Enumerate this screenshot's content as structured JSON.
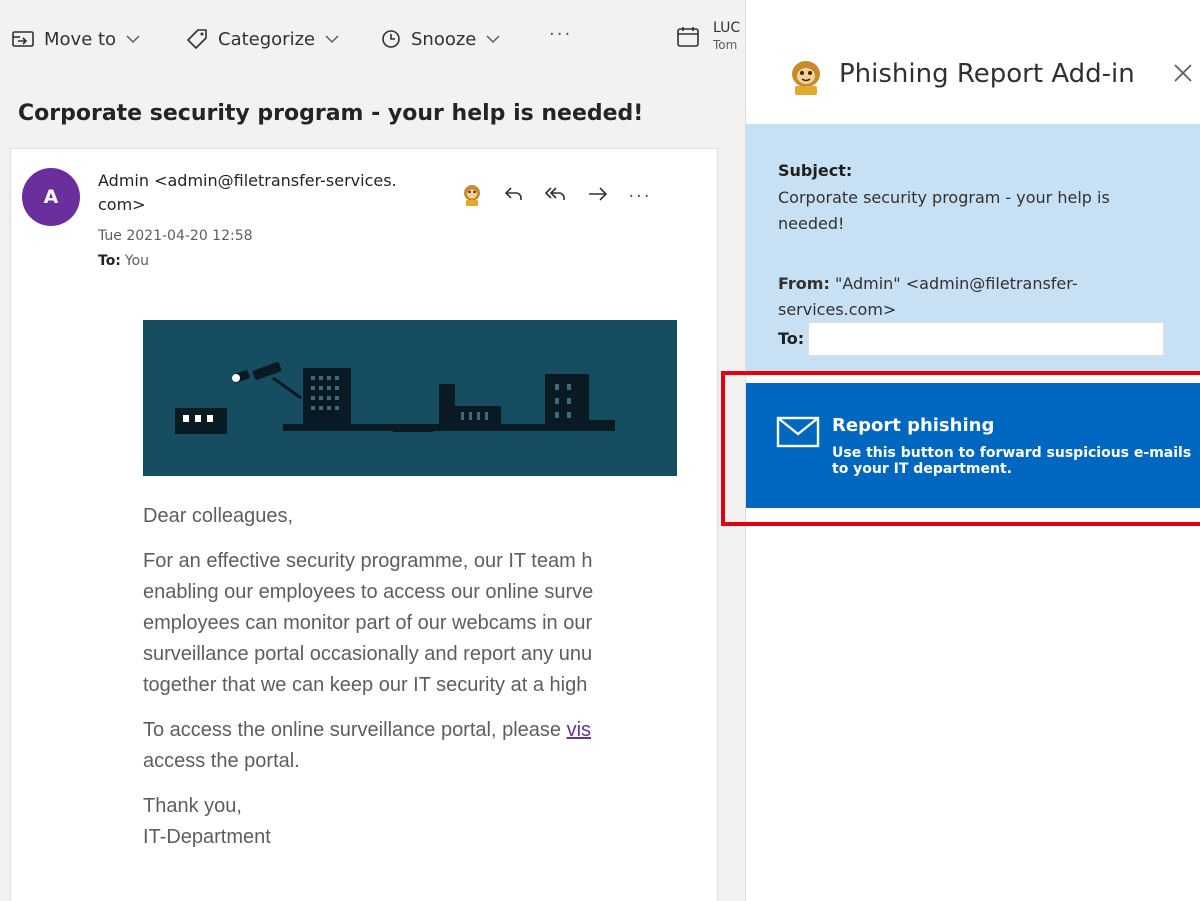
{
  "toolbar": {
    "move_to_label": "Move to",
    "categorize_label": "Categorize",
    "snooze_label": "Snooze",
    "more_label": "···",
    "peek_name": "LUC",
    "peek_sub": "Tom"
  },
  "email": {
    "subject": "Corporate security program - your help is needed!",
    "avatar_initial": "A",
    "sender": "Admin <admin@filetransfer-services.com>",
    "date": "Tue 2021-04-20 12:58",
    "to_label": "To:",
    "to_value": "You",
    "more_label": "···",
    "body": {
      "greeting": "Dear colleagues,",
      "para1_lines": [
        "For an effective security programme, our IT team h",
        "enabling our employees to access our online surve",
        "employees can monitor part of our webcams in our",
        "surveillance portal occasionally and report any unu",
        "together that we can keep our IT security at a high"
      ],
      "para2_line1_text": "To access the online surveillance portal, please ",
      "para2_link": "vis",
      "para2_line2": "access the portal.",
      "closing": "Thank you,",
      "signature": "IT-Department"
    }
  },
  "addin": {
    "title": "Phishing Report Add-in",
    "subject_label": "Subject:",
    "subject_value": "Corporate security program - your help is needed!",
    "from_label": "From:",
    "from_value": "\"Admin\" <admin@filetransfer-services.com>",
    "to_label": "To:",
    "report_title": "Report phishing",
    "report_desc": "Use this button to forward suspicious e-mails to your IT department."
  },
  "colors": {
    "avatar": "#6b2e9d",
    "banner": "#174d61",
    "info_bg": "#c7e0f4",
    "report_button": "#0067c0",
    "highlight_outline": "#e3000f",
    "link": "#6b2e9d"
  },
  "icons": [
    "move-to-icon",
    "categorize-icon",
    "snooze-icon",
    "chevron-down-icon",
    "calendar-icon",
    "phishing-report-addin-icon",
    "reply-icon",
    "reply-all-icon",
    "forward-icon",
    "close-icon",
    "envelope-icon"
  ]
}
